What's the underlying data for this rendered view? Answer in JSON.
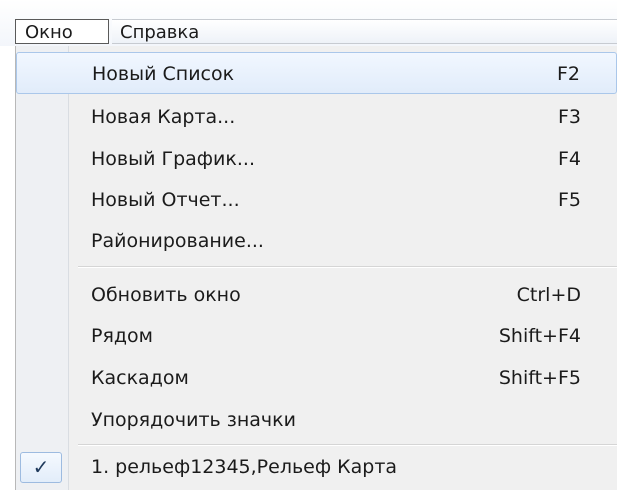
{
  "menubar": {
    "window_label": "Окно",
    "help_label": "Справка"
  },
  "menu": {
    "items": [
      {
        "label": "Новый Список",
        "shortcut": "F2",
        "highlighted": true
      },
      {
        "label": "Новая Карта...",
        "shortcut": "F3"
      },
      {
        "label": "Новый График...",
        "shortcut": "F4"
      },
      {
        "label": "Новый Отчет...",
        "shortcut": "F5"
      },
      {
        "label": "Районирование...",
        "shortcut": ""
      },
      {
        "label": "Обновить окно",
        "shortcut": "Ctrl+D"
      },
      {
        "label": "Рядом",
        "shortcut": "Shift+F4"
      },
      {
        "label": "Каскадом",
        "shortcut": "Shift+F5"
      },
      {
        "label": "Упорядочить значки",
        "shortcut": ""
      },
      {
        "label": "1. рельеф12345,Рельеф Карта",
        "shortcut": "",
        "checked": true,
        "check_symbol": "✓"
      }
    ]
  },
  "colors": {
    "highlight_border": "#aac7ea",
    "menu_background": "#f0f0f0"
  }
}
